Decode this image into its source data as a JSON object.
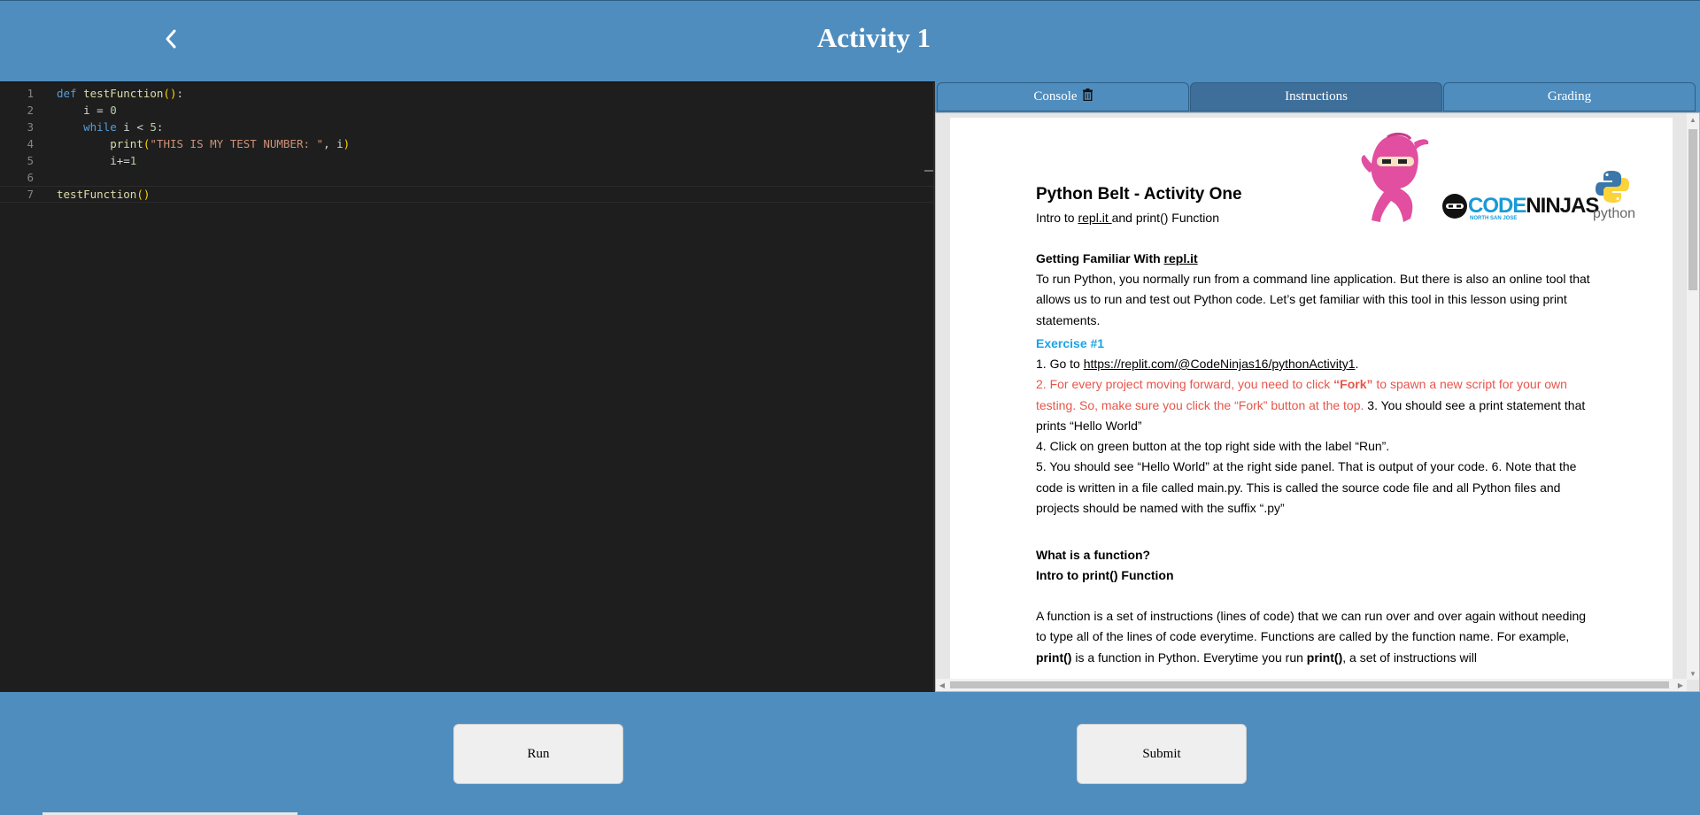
{
  "header": {
    "title": "Activity 1",
    "back_icon": "chevron-left-icon"
  },
  "editor": {
    "lines": [
      {
        "num": "1",
        "tokens": [
          {
            "t": "def",
            "c": "kw"
          },
          {
            "t": " "
          },
          {
            "t": "testFunction",
            "c": "fn"
          },
          {
            "t": "()",
            "c": "pn"
          },
          {
            "t": ":"
          }
        ]
      },
      {
        "num": "2",
        "tokens": [
          {
            "t": "    i = "
          },
          {
            "t": "0",
            "c": "num"
          }
        ]
      },
      {
        "num": "3",
        "tokens": [
          {
            "t": "    "
          },
          {
            "t": "while",
            "c": "kw"
          },
          {
            "t": " i < "
          },
          {
            "t": "5",
            "c": "num"
          },
          {
            "t": ":"
          }
        ]
      },
      {
        "num": "4",
        "tokens": [
          {
            "t": "        "
          },
          {
            "t": "print",
            "c": "fn"
          },
          {
            "t": "(",
            "c": "pn"
          },
          {
            "t": "\"THIS IS MY TEST NUMBER: \"",
            "c": "str"
          },
          {
            "t": ", i"
          },
          {
            "t": ")",
            "c": "pn"
          }
        ]
      },
      {
        "num": "5",
        "tokens": [
          {
            "t": "        i+="
          },
          {
            "t": "1",
            "c": "num"
          }
        ]
      },
      {
        "num": "6",
        "tokens": []
      },
      {
        "num": "7",
        "tokens": [
          {
            "t": "testFunction",
            "c": "fn"
          },
          {
            "t": "()",
            "c": "pn"
          }
        ]
      }
    ],
    "active_line": 7
  },
  "tabs": [
    {
      "label": "Console",
      "icon": "trash-icon",
      "active": false
    },
    {
      "label": "Instructions",
      "active": true
    },
    {
      "label": "Grading",
      "active": false
    }
  ],
  "doc": {
    "title": "Python Belt - Activity One",
    "subtitle_pre": "Intro to ",
    "subtitle_link": "repl.it ",
    "subtitle_post": "and print() Function",
    "logo_brand": "CODE NINJAS",
    "logo_sub": "NORTH SAN JOSE",
    "python_logo_text": "python",
    "section1_heading_pre": "Getting Familiar With ",
    "section1_heading_link": "repl.it",
    "section1_body": "To run Python, you normally run from a command line application. But there is also an  online tool that allows us to run and test out Python code. Let’s get familiar with this tool in  this lesson using print statements.",
    "exercise_heading": "Exercise #1",
    "step1_pre": "1. Go to ",
    "step1_link": "https://replit.com/@CodeNinjas16/pythonActivity1",
    "step1_post": ".",
    "step2_a": "2. For every project moving forward, you need to click ",
    "step2_b": "“Fork”",
    "step2_c": " to spawn a new script for your own testing. So, make sure you click the “Fork” button at the top.",
    "step3": " 3. You should see a print statement that prints “Hello World”",
    "step4": "4. Click on green button at the top right side with the label “Run”.",
    "step5": "5. You should see “Hello World” at the right side panel. That is output of your code. 6. Note that the code is written in a file called main.py. This is called the source code file  and all Python files and projects should be named with the suffix “.py”",
    "q_heading": "What is a function?",
    "q_heading2": "Intro to print() Function",
    "func_a": "A function is a set of instructions (lines of code) that we can run over and over again  without needing to type all of the lines of code everytime. Functions are called by the  function name. For example, ",
    "func_b": "print()",
    "func_c": " is a function in Python. Everytime you run ",
    "func_d": "print()",
    "func_e": ", a set  of instructions will"
  },
  "footer": {
    "run_label": "Run",
    "submit_label": "Submit"
  }
}
